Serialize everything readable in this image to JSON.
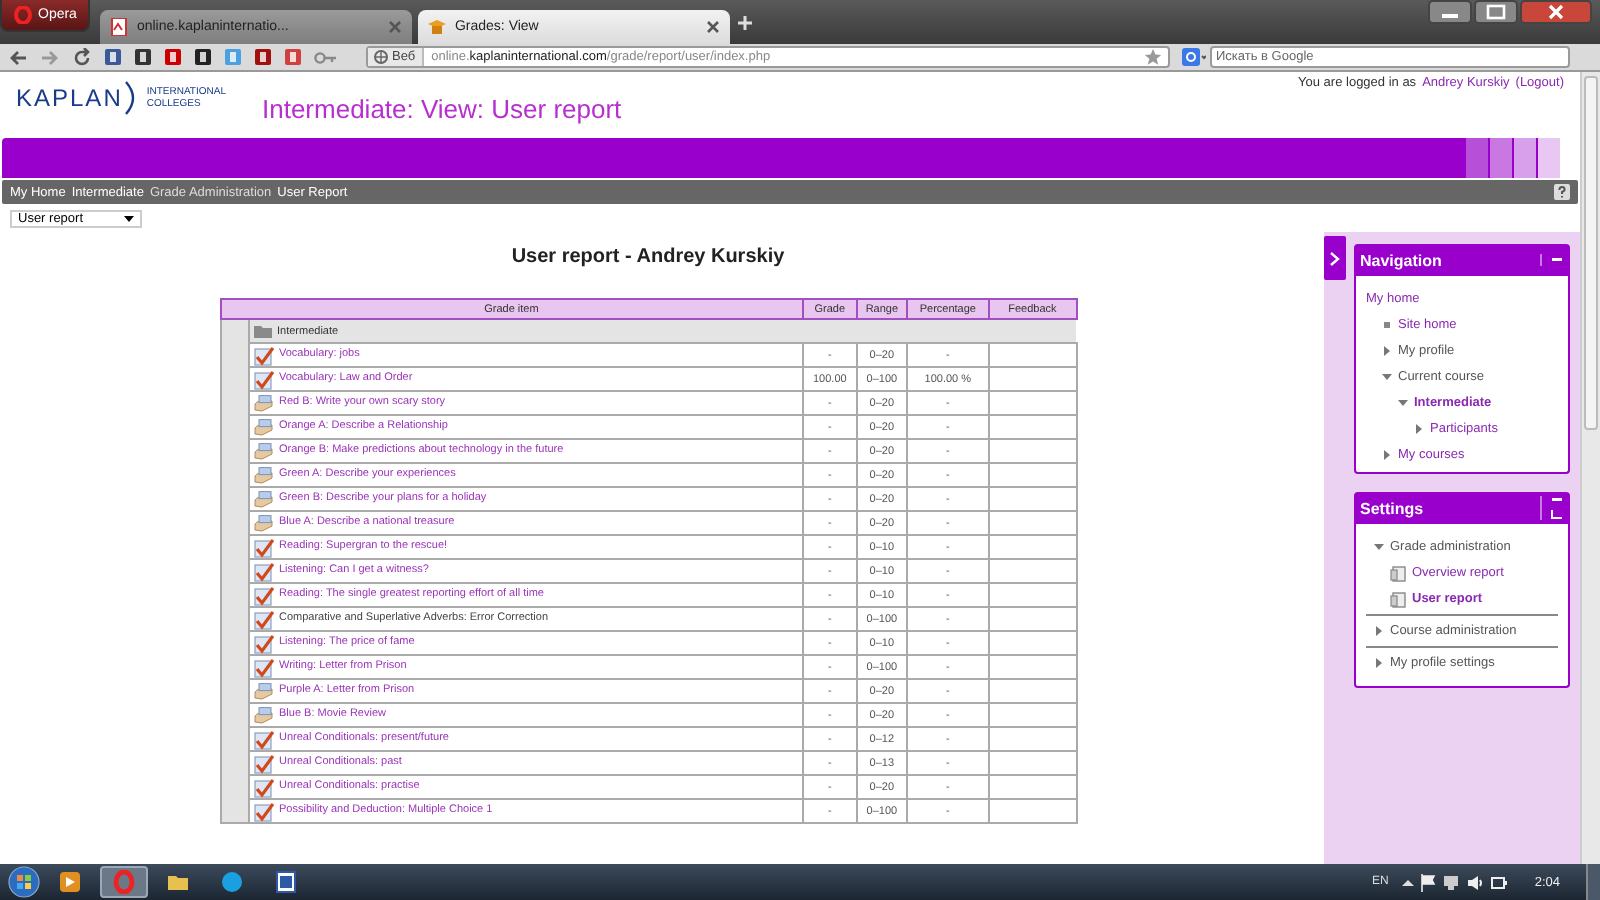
{
  "browser": {
    "menu_button": "Opera",
    "tabs": [
      {
        "title": "online.kaplaninternatio...",
        "selected": false
      },
      {
        "title": "Grades: View",
        "selected": true
      }
    ],
    "address": {
      "badge": "Веб",
      "url": "online.**kaplaninternational.com**/grade/report/user/index.php"
    },
    "search": {
      "placeholder": "Искать в Google"
    }
  },
  "header": {
    "logo": {
      "name": "KAPLAN",
      "tagline_1": "INTERNATIONAL",
      "tagline_2": "COLLEGES"
    },
    "title": "Intermediate: View: User report",
    "login": {
      "prefix": "You are logged in as",
      "user": "Andrey Kurskiy",
      "logout": "(Logout)"
    }
  },
  "breadcrumb": [
    "My Home",
    "Intermediate",
    "Grade Administration",
    "User Report"
  ],
  "report_select": {
    "value": "User report"
  },
  "report": {
    "heading": "User report - Andrey Kurskiy",
    "columns": [
      "Grade item",
      "Grade",
      "Range",
      "Percentage",
      "Feedback"
    ],
    "category": "Intermediate",
    "rows": [
      {
        "kind": "quiz",
        "item": "Vocabulary: jobs",
        "link": true,
        "grade": "-",
        "range": "0–20",
        "percentage": "-"
      },
      {
        "kind": "quiz",
        "item": "Vocabulary: Law and Order",
        "link": true,
        "grade": "100.00",
        "range": "0–100",
        "percentage": "100.00 %"
      },
      {
        "kind": "assignment",
        "item": "Red B: Write your own scary story",
        "link": true,
        "grade": "-",
        "range": "0–20",
        "percentage": "-"
      },
      {
        "kind": "assignment",
        "item": "Orange A: Describe a Relationship",
        "link": true,
        "grade": "-",
        "range": "0–20",
        "percentage": "-"
      },
      {
        "kind": "assignment",
        "item": "Orange B: Make predictions about technology in the future",
        "link": true,
        "grade": "-",
        "range": "0–20",
        "percentage": "-"
      },
      {
        "kind": "assignment",
        "item": "Green A: Describe your experiences",
        "link": true,
        "grade": "-",
        "range": "0–20",
        "percentage": "-"
      },
      {
        "kind": "assignment",
        "item": "Green B: Describe your plans for a holiday",
        "link": true,
        "grade": "-",
        "range": "0–20",
        "percentage": "-"
      },
      {
        "kind": "assignment",
        "item": "Blue A: Describe a national treasure",
        "link": true,
        "grade": "-",
        "range": "0–20",
        "percentage": "-"
      },
      {
        "kind": "quiz",
        "item": "Reading: Supergran to the rescue!",
        "link": true,
        "grade": "-",
        "range": "0–10",
        "percentage": "-"
      },
      {
        "kind": "quiz",
        "item": "Listening: Can I get a witness?",
        "link": true,
        "grade": "-",
        "range": "0–10",
        "percentage": "-"
      },
      {
        "kind": "quiz",
        "item": "Reading: The single greatest reporting effort of all time",
        "link": true,
        "grade": "-",
        "range": "0–10",
        "percentage": "-"
      },
      {
        "kind": "quiz",
        "item": "Comparative and Superlative Adverbs: Error Correction",
        "link": false,
        "grade": "-",
        "range": "0–100",
        "percentage": "-"
      },
      {
        "kind": "quiz",
        "item": "Listening: The price of fame",
        "link": true,
        "grade": "-",
        "range": "0–10",
        "percentage": "-"
      },
      {
        "kind": "quiz",
        "item": "Writing: Letter from Prison",
        "link": true,
        "grade": "-",
        "range": "0–100",
        "percentage": "-"
      },
      {
        "kind": "assignment",
        "item": "Purple A: Letter from Prison",
        "link": true,
        "grade": "-",
        "range": "0–20",
        "percentage": "-"
      },
      {
        "kind": "assignment",
        "item": "Blue B: Movie Review",
        "link": true,
        "grade": "-",
        "range": "0–20",
        "percentage": "-"
      },
      {
        "kind": "quiz",
        "item": "Unreal Conditionals: present/future",
        "link": true,
        "grade": "-",
        "range": "0–12",
        "percentage": "-"
      },
      {
        "kind": "quiz",
        "item": "Unreal Conditionals: past",
        "link": true,
        "grade": "-",
        "range": "0–13",
        "percentage": "-"
      },
      {
        "kind": "quiz",
        "item": "Unreal Conditionals: practise",
        "link": true,
        "grade": "-",
        "range": "0–20",
        "percentage": "-"
      },
      {
        "kind": "quiz",
        "item": "Possibility and Deduction: Multiple Choice 1",
        "link": true,
        "grade": "-",
        "range": "0–100",
        "percentage": "-"
      }
    ]
  },
  "navigation": {
    "title": "Navigation",
    "items": [
      {
        "label": "My home",
        "kind": "root",
        "link": true,
        "current": false,
        "children": [
          {
            "label": "Site home",
            "kind": "leaf",
            "link": true,
            "current": false
          },
          {
            "label": "My profile",
            "kind": "branch",
            "expanded": false,
            "link": false,
            "current": false
          },
          {
            "label": "Current course",
            "kind": "branch",
            "expanded": true,
            "link": false,
            "current": false,
            "children": [
              {
                "label": "Intermediate",
                "kind": "branch",
                "expanded": true,
                "link": true,
                "current": true,
                "children": [
                  {
                    "label": "Participants",
                    "kind": "branch",
                    "expanded": false,
                    "link": true,
                    "current": false
                  }
                ]
              }
            ]
          },
          {
            "label": "My courses",
            "kind": "branch",
            "expanded": false,
            "link": true,
            "current": false
          }
        ]
      }
    ]
  },
  "settings": {
    "title": "Settings",
    "items": [
      {
        "label": "Grade administration",
        "kind": "branch",
        "expanded": true,
        "link": false,
        "current": false,
        "children": [
          {
            "label": "Overview report",
            "kind": "page",
            "link": true,
            "current": false
          },
          {
            "label": "User report",
            "kind": "page",
            "link": true,
            "current": true
          }
        ]
      },
      {
        "label": "Course administration",
        "kind": "branch",
        "expanded": false,
        "link": false,
        "current": false
      },
      {
        "label": "My profile settings",
        "kind": "branch",
        "expanded": false,
        "link": false,
        "current": false
      }
    ]
  },
  "taskbar": {
    "apps": [
      {
        "kind": "media",
        "selected": false
      },
      {
        "kind": "opera",
        "selected": true
      },
      {
        "kind": "folder",
        "selected": false
      },
      {
        "kind": "skype",
        "selected": false
      },
      {
        "kind": "word",
        "selected": false
      }
    ],
    "language": "EN",
    "time": "2:04"
  }
}
